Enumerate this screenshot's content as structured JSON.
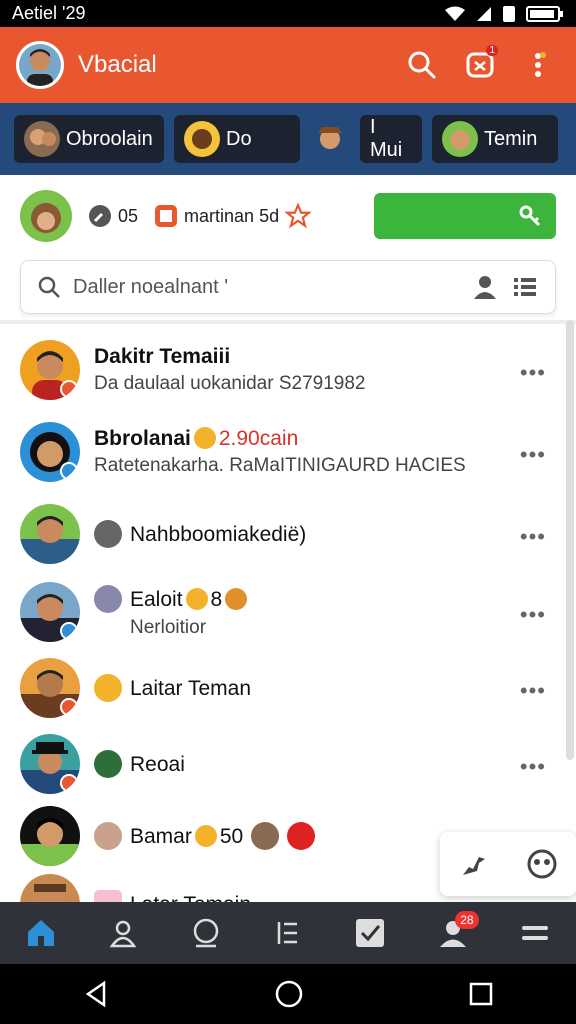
{
  "status_bar": {
    "time": "Aetiel '29"
  },
  "app_bar": {
    "title": "Vbacial",
    "notif_badge": "1"
  },
  "stories": [
    {
      "label": "Obroolain"
    },
    {
      "label": "Do"
    },
    {
      "label": "I Mui"
    },
    {
      "label": "Temin"
    }
  ],
  "quick": {
    "count_label": "05",
    "tag_label": "martinan 5d"
  },
  "search": {
    "placeholder": "Daller noealnant '"
  },
  "contacts": [
    {
      "name": "Dakitr Temaiii",
      "sub": "Da daulaal uokanidar S2791982",
      "badge_color": "#e8572f"
    },
    {
      "name": "Bbrolanai",
      "extra": "2.90cain",
      "sub": "Ratetenakarha. RaMaITINIGAURD HACIES",
      "badge_color": "#2d8fd5"
    },
    {
      "name": "Nahbboomiakedië)",
      "badge_color": null
    },
    {
      "name": "Ealoit",
      "extra": "8",
      "sub": "Nerloitior",
      "badge_color": "#2d8fd5"
    },
    {
      "name": "Laitar Teman",
      "badge_color": "#e8572f"
    },
    {
      "name": "Reoai",
      "badge_color": "#e8572f"
    },
    {
      "name": "Bamar",
      "extra": "50",
      "badge_color": null
    },
    {
      "name": "Latar Temain",
      "badge_color": null
    }
  ],
  "bottom_nav": {
    "count": "28"
  },
  "colors": {
    "primary": "#e8572f",
    "strip": "#234a7a",
    "action": "#3bb53c",
    "nav": "#2f3238"
  }
}
